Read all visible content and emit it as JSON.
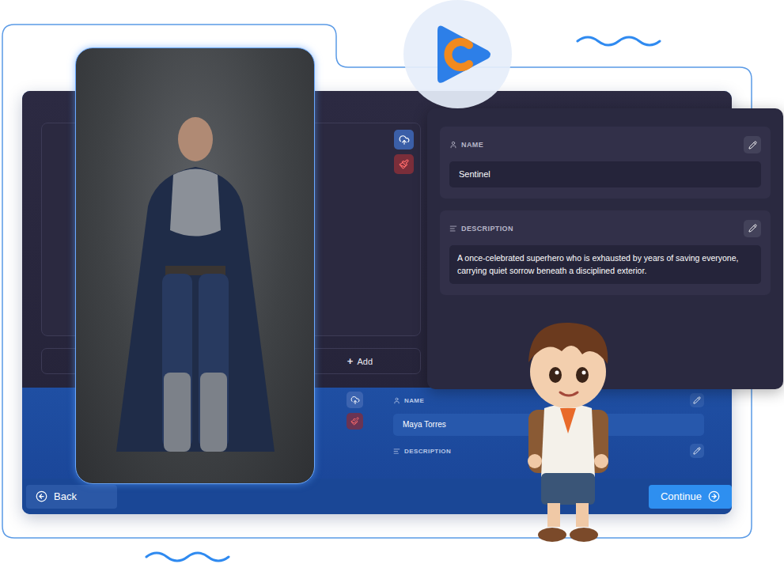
{
  "character_cards": [
    {
      "name_label": "NAME",
      "name": "Sentinel",
      "description_label": "DESCRIPTION",
      "description": "A once-celebrated superhero who is exhausted by years of saving everyone, carrying quiet  sorrow beneath a disciplined exterior."
    },
    {
      "name_label": "NAME",
      "name": "Maya Torres",
      "description_label": "DESCRIPTION"
    }
  ],
  "add_button": {
    "icon": "+",
    "label": "Add"
  },
  "footer": {
    "back": "Back",
    "continue": "Continue"
  }
}
